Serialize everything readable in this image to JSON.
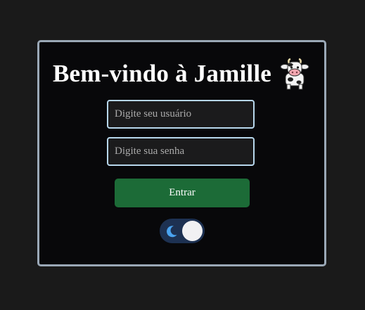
{
  "login": {
    "title": "Bem-vindo à Jamille",
    "title_icon": "cow-icon",
    "username_placeholder": "Digite seu usuário",
    "username_value": "",
    "password_placeholder": "Digite sua senha",
    "password_value": "",
    "submit_label": "Entrar"
  },
  "theme_toggle": {
    "icon": "moon-icon",
    "state": "dark"
  },
  "colors": {
    "page_background": "#1a1a1a",
    "card_background": "#08080a",
    "card_border": "#9aa8b6",
    "input_border": "#b7d7ec",
    "button": "#1c6b37",
    "toggle_track": "#1d3152",
    "moon": "#4aa3f0"
  }
}
